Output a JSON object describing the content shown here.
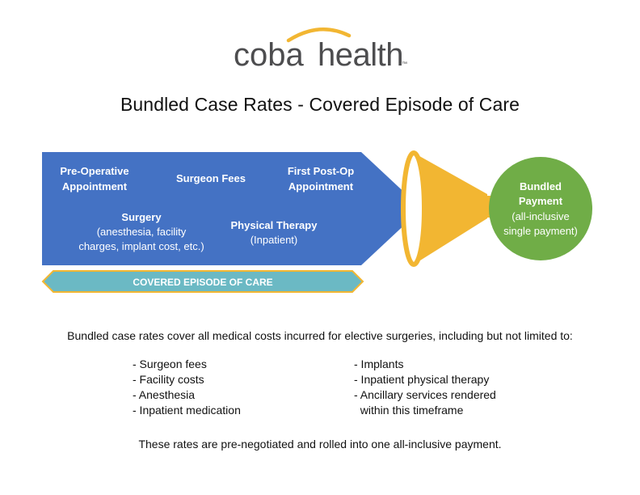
{
  "logo": {
    "wordmark_primary": "coba",
    "wordmark_secondary": "health",
    "trademark": "™",
    "color_text": "#4d4d4f",
    "color_arc": "#f2b632"
  },
  "title": "Bundled Case Rates - Covered Episode of Care",
  "diagram": {
    "arrow_color": "#4472c4",
    "funnel_color": "#f2b632",
    "bar_color": "#6bb9c4",
    "bar_border_color": "#f2b632",
    "circle_color": "#70ad47",
    "items": {
      "pre_op_line1": "Pre-Operative",
      "pre_op_line2": "Appointment",
      "surgeon_fees": "Surgeon Fees",
      "post_op_line1": "First Post-Op",
      "post_op_line2": "Appointment",
      "surgery": "Surgery",
      "surgery_detail_line1": "(anesthesia, facility",
      "surgery_detail_line2": "charges, implant cost, etc.)",
      "physical_therapy": "Physical Therapy",
      "physical_therapy_detail": "(Inpatient)"
    },
    "covered_label": "COVERED EPISODE OF CARE",
    "outcome": {
      "line1": "Bundled",
      "line2": "Payment",
      "line3": "(all-inclusive",
      "line4": "single payment)"
    }
  },
  "intro": "Bundled case rates cover all medical costs incurred for elective surgeries, including but not limited to:",
  "list_left": [
    "- Surgeon fees",
    "- Facility costs",
    "- Anesthesia",
    "- Inpatient medication"
  ],
  "list_right": [
    "- Implants",
    "- Inpatient physical therapy",
    "- Ancillary services rendered",
    "  within this timeframe"
  ],
  "footer": "These rates are pre-negotiated and rolled into one all-inclusive payment."
}
